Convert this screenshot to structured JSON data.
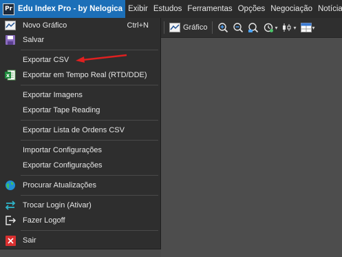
{
  "app": {
    "icon_text": "Pr",
    "title": "Edu Index Pro - by Nelogica"
  },
  "menubar": {
    "items": [
      "Exibir",
      "Estudos",
      "Ferramentas",
      "Opções",
      "Negociação",
      "Notícias"
    ]
  },
  "toolbar": {
    "chart_label": "Gráfico",
    "icons": [
      "line-chart-icon",
      "zoom-in-icon",
      "zoom-out-icon",
      "zoom-fit-icon",
      "refresh-time-icon",
      "candle-chart-icon",
      "layout-grid-icon"
    ]
  },
  "file_menu": {
    "items": [
      {
        "label": "Novo Gráfico",
        "shortcut": "Ctrl+N",
        "icon": "chart-icon"
      },
      {
        "label": "Salvar",
        "icon": "save-icon"
      },
      {
        "label": "Exportar CSV"
      },
      {
        "label": "Exportar em Tempo Real (RTD/DDE)",
        "icon": "excel-icon"
      },
      {
        "label": "Exportar Imagens"
      },
      {
        "label": "Exportar Tape Reading"
      },
      {
        "label": "Exportar Lista de Ordens CSV"
      },
      {
        "label": "Importar Configurações"
      },
      {
        "label": "Exportar Configurações"
      },
      {
        "label": "Procurar Atualizações",
        "icon": "globe-icon"
      },
      {
        "label": "Trocar Login (Ativar)",
        "icon": "swap-icon"
      },
      {
        "label": "Fazer Logoff",
        "icon": "logoff-icon"
      },
      {
        "label": "Sair",
        "icon": "close-icon"
      }
    ]
  },
  "colors": {
    "title_bg": "#1c6fb8",
    "menu_bg": "#2e2e2e",
    "annotation_arrow": "#e02020",
    "exit_icon": "#d93030"
  }
}
